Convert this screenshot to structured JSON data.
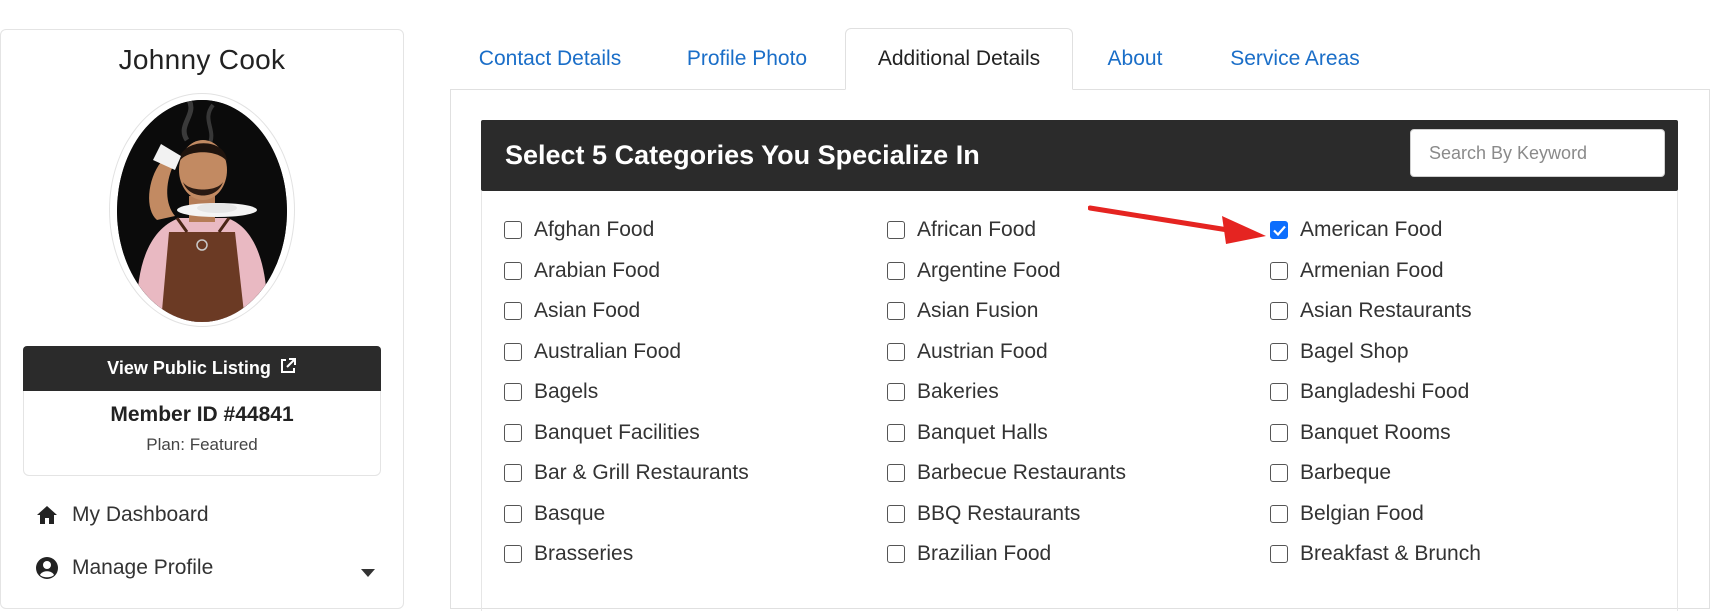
{
  "profile": {
    "name": "Johnny Cook",
    "view_listing_label": "View Public Listing",
    "member_id": "Member ID #44841",
    "plan": "Plan: Featured"
  },
  "nav": {
    "items": [
      {
        "label": "My Dashboard",
        "icon": "home-icon"
      },
      {
        "label": "Manage Profile",
        "icon": "user-circle-icon"
      }
    ]
  },
  "tabs": [
    {
      "label": "Contact Details",
      "active": false
    },
    {
      "label": "Profile Photo",
      "active": false
    },
    {
      "label": "Additional Details",
      "active": true
    },
    {
      "label": "About",
      "active": false
    },
    {
      "label": "Service Areas",
      "active": false
    }
  ],
  "categories": {
    "title": "Select 5 Categories You Specialize In",
    "search_placeholder": "Search By Keyword",
    "search_value": "",
    "items": [
      {
        "label": "Afghan Food",
        "checked": false
      },
      {
        "label": "African Food",
        "checked": false
      },
      {
        "label": "American Food",
        "checked": true
      },
      {
        "label": "Arabian Food",
        "checked": false
      },
      {
        "label": "Argentine Food",
        "checked": false
      },
      {
        "label": "Armenian Food",
        "checked": false
      },
      {
        "label": "Asian Food",
        "checked": false
      },
      {
        "label": "Asian Fusion",
        "checked": false
      },
      {
        "label": "Asian Restaurants",
        "checked": false
      },
      {
        "label": "Australian Food",
        "checked": false
      },
      {
        "label": "Austrian Food",
        "checked": false
      },
      {
        "label": "Bagel Shop",
        "checked": false
      },
      {
        "label": "Bagels",
        "checked": false
      },
      {
        "label": "Bakeries",
        "checked": false
      },
      {
        "label": "Bangladeshi Food",
        "checked": false
      },
      {
        "label": "Banquet Facilities",
        "checked": false
      },
      {
        "label": "Banquet Halls",
        "checked": false
      },
      {
        "label": "Banquet Rooms",
        "checked": false
      },
      {
        "label": "Bar & Grill Restaurants",
        "checked": false
      },
      {
        "label": "Barbecue Restaurants",
        "checked": false
      },
      {
        "label": "Barbeque",
        "checked": false
      },
      {
        "label": "Basque",
        "checked": false
      },
      {
        "label": "BBQ Restaurants",
        "checked": false
      },
      {
        "label": "Belgian Food",
        "checked": false
      },
      {
        "label": "Brasseries",
        "checked": false
      },
      {
        "label": "Brazilian Food",
        "checked": false
      },
      {
        "label": "Breakfast & Brunch",
        "checked": false
      }
    ]
  },
  "colors": {
    "link": "#1a6ec8",
    "dark": "#2b2b2b",
    "checkbox_checked": "#0d6efd",
    "annotation_arrow": "#e52421"
  }
}
